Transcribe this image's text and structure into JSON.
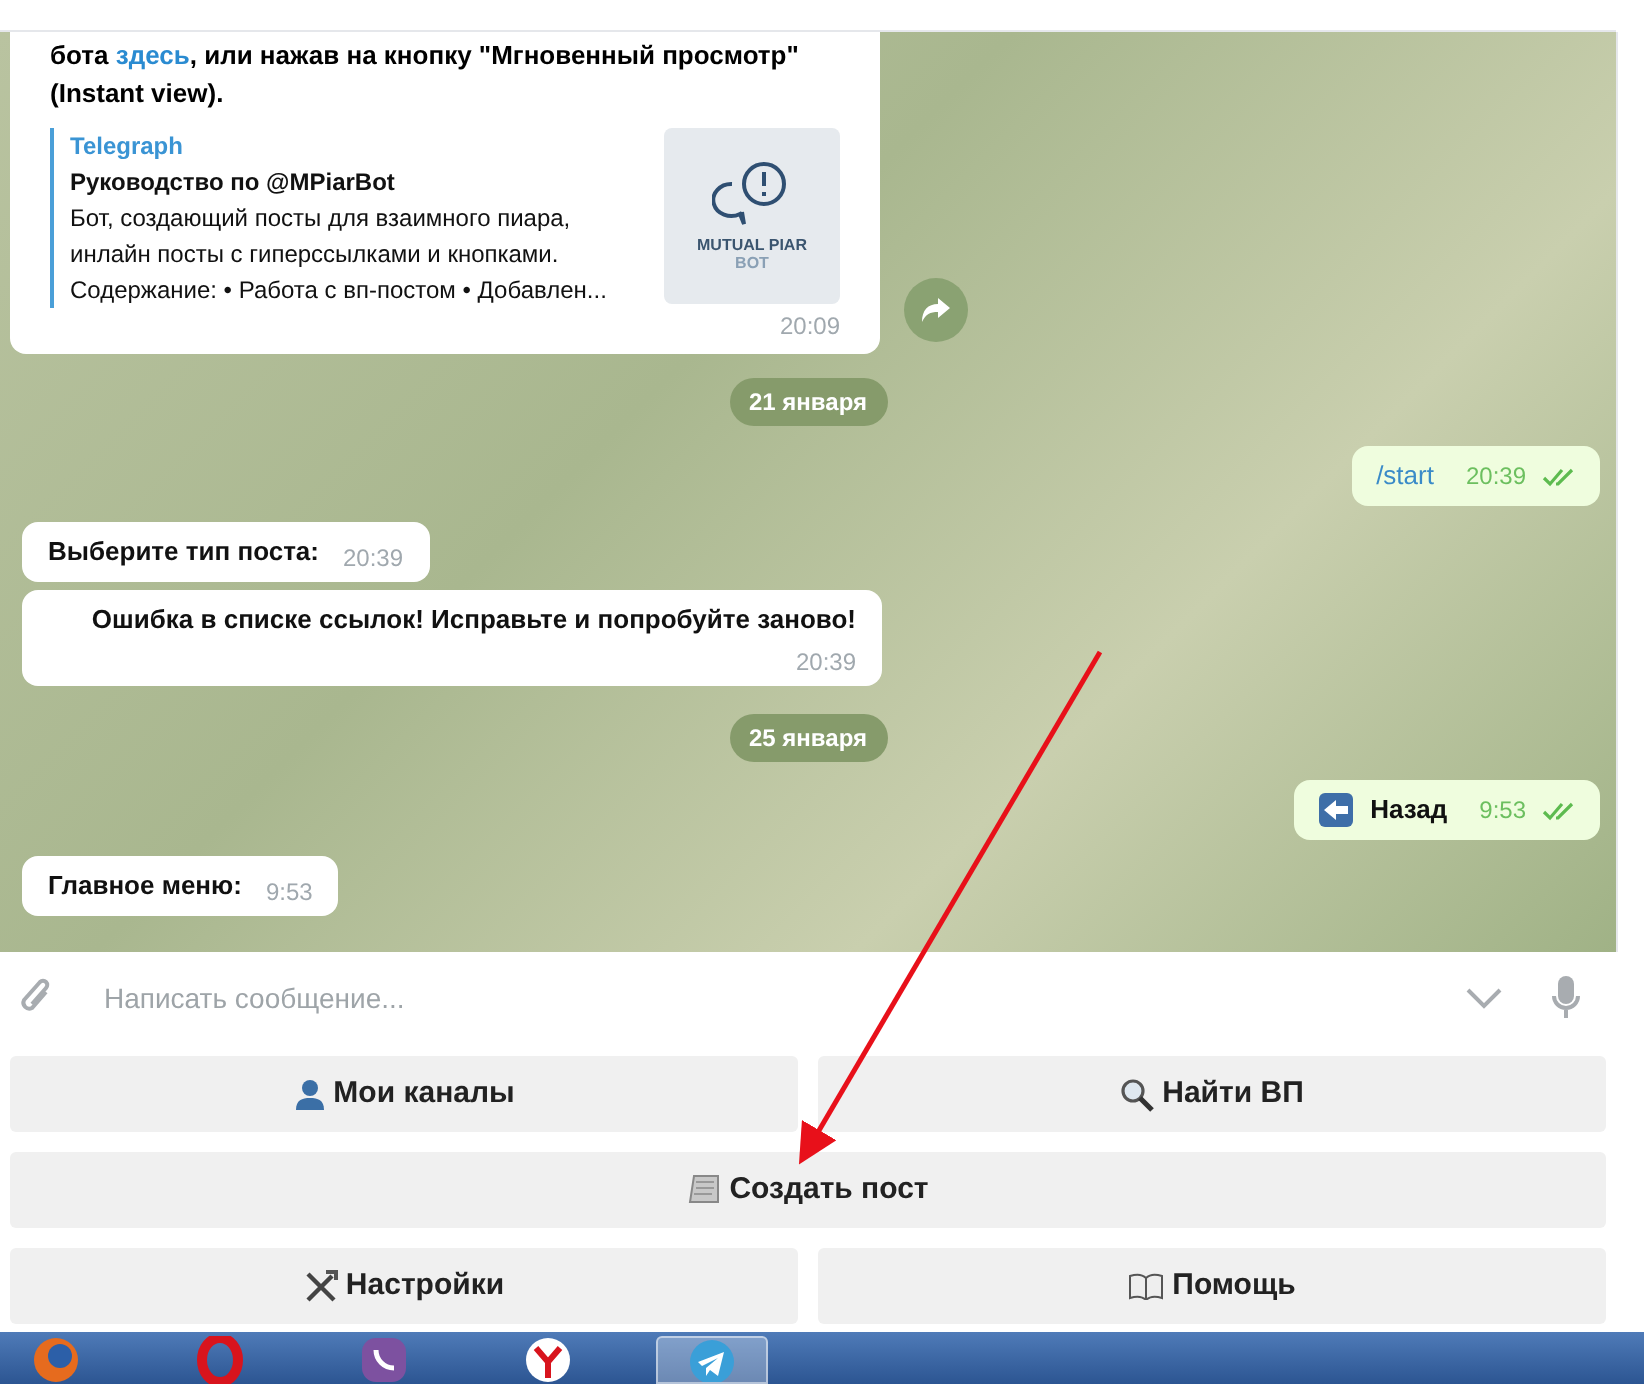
{
  "messages": [
    {
      "kind": "incoming",
      "text": "бота **здесь**, или нажав на кнопку \"Мгновенный просмотр\" (Instant view).",
      "preview": {
        "site": "Telegraph",
        "title": "Руководство по @MPiarBot",
        "description": "Бот, создающий посты для взаимного пиара, инлайн посты с гиперссылками и кнопками. Содержание: • Работа с вп-постом • Добавлен...",
        "image_text": "MUTUAL PIAR",
        "image_subtext": "BOT"
      },
      "time": "20:09",
      "forward": true
    },
    {
      "kind": "date",
      "text": "21 января"
    },
    {
      "kind": "outgoing",
      "text": "/start",
      "command": true,
      "time": "20:39",
      "read": true
    },
    {
      "kind": "incoming",
      "text": "Выберите тип поста:",
      "time": "20:39"
    },
    {
      "kind": "incoming",
      "text": "Ошибка в списке ссылок! Исправьте и попробуйте заново!",
      "time": "20:39"
    },
    {
      "kind": "date",
      "text": "25 января"
    },
    {
      "kind": "outgoing",
      "text": "Назад",
      "command": false,
      "time": "9:53",
      "read": true
    },
    {
      "kind": "incoming",
      "text": "Главное меню:",
      "time": "9:53"
    }
  ],
  "composer": {
    "placeholder": "Написать сообщение..."
  },
  "keyboard": [
    [
      {
        "label": "Мои каналы"
      },
      {
        "label": "Найти ВП"
      }
    ],
    [
      {
        "label": "Создать пост"
      }
    ],
    [
      {
        "label": "Настройки"
      },
      {
        "label": "Помощь"
      }
    ]
  ],
  "taskbar": [
    {
      "selected": false
    },
    {
      "selected": false
    },
    {
      "selected": false
    },
    {
      "selected": false
    },
    {
      "selected": true
    }
  ]
}
